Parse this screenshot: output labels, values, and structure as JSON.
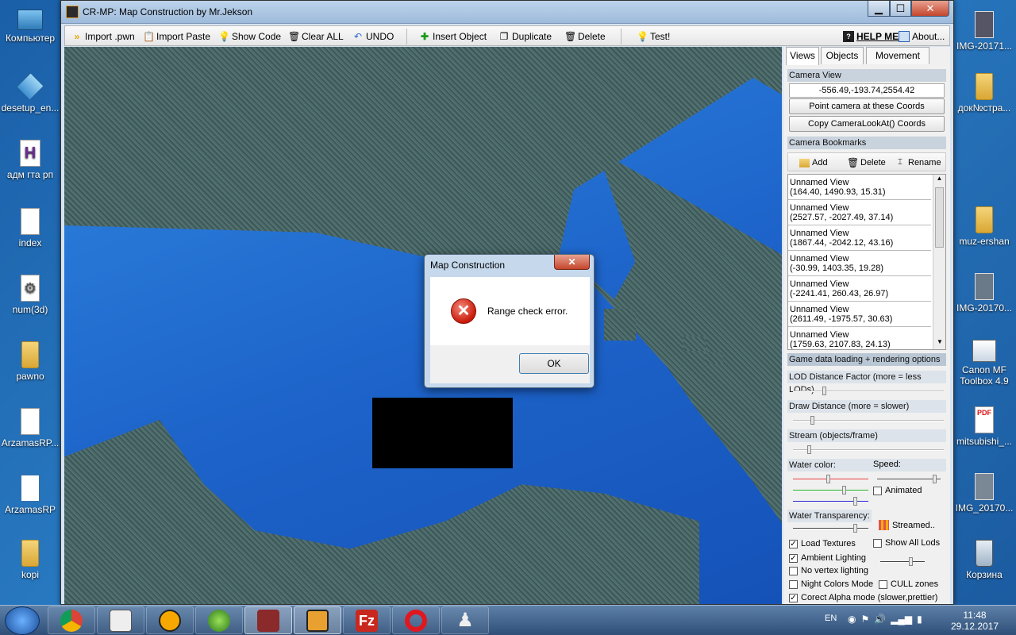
{
  "desktop": {
    "icons_left": [
      {
        "label": "Компьютер",
        "icon": "computer-icon"
      },
      {
        "label": "desetup_en...",
        "icon": "package-icon"
      },
      {
        "label": "адм гта рп",
        "icon": "h-app-icon"
      },
      {
        "label": "index",
        "icon": "text-file-icon"
      },
      {
        "label": "num(3d)",
        "icon": "settings-file-icon"
      },
      {
        "label": "pawno",
        "icon": "folder-icon"
      },
      {
        "label": "ArzamasRP...",
        "icon": "file-icon"
      },
      {
        "label": "ArzamasRP",
        "icon": "config-file-icon"
      },
      {
        "label": "kopi",
        "icon": "folder-icon"
      }
    ],
    "icons_right": [
      {
        "label": "IMG-20171...",
        "icon": "image-icon"
      },
      {
        "label": "док№стра...",
        "icon": "folder-icon"
      },
      {
        "label": "muz-ershan",
        "icon": "folder-icon"
      },
      {
        "label": "IMG-20170...",
        "icon": "image-icon"
      },
      {
        "label": "Canon MF Toolbox 4.9",
        "icon": "canon-icon"
      },
      {
        "label": "mitsubishi_...",
        "icon": "pdf-icon"
      },
      {
        "label": "IMG_20170...",
        "icon": "image-icon"
      },
      {
        "label": "Корзина",
        "icon": "recycle-bin-icon"
      }
    ]
  },
  "window": {
    "title": "CR-MP: Map Construction by Mr.Jekson",
    "controls": {
      "minimize": "▁",
      "maximize": "☐",
      "close": "✕"
    }
  },
  "toolbar": {
    "import_pwn": "Import .pwn",
    "import_paste": "Import Paste",
    "show_code": "Show Code",
    "clear_all": "Clear ALL",
    "undo": "UNDO",
    "insert_object": "Insert Object",
    "duplicate": "Duplicate",
    "delete": "Delete",
    "test": "Test!",
    "help": "HELP ME",
    "about": "About..."
  },
  "panel": {
    "tabs": [
      "Views",
      "Objects",
      "Movement"
    ],
    "camera_view_header": "Camera View",
    "camera_coords": "-556.49,-193.74,2554.42",
    "point_camera_button": "Point camera at these Coords",
    "copy_lookat_button": "Copy CameraLookAt() Coords",
    "bookmarks_header": "Camera Bookmarks",
    "bm_add": "Add",
    "bm_delete": "Delete",
    "bm_rename": "Rename",
    "bookmarks": [
      {
        "name": "Unnamed View",
        "coords": "(164.40, 1490.93, 15.31)"
      },
      {
        "name": "Unnamed View",
        "coords": "(2527.57, -2027.49, 37.14)"
      },
      {
        "name": "Unnamed View",
        "coords": "(1867.44, -2042.12, 43.16)"
      },
      {
        "name": "Unnamed View",
        "coords": "(-30.99, 1403.35, 19.28)"
      },
      {
        "name": "Unnamed View",
        "coords": "(-2241.41, 260.43, 26.97)"
      },
      {
        "name": "Unnamed View",
        "coords": "(2611.49, -1975.57, 30.63)"
      },
      {
        "name": "Unnamed View",
        "coords": "(1759.63, 2107.83, 24.13)"
      }
    ],
    "game_data_header": "Game data loading  + rendering options",
    "lod_label": "LOD Distance Factor (more = less LODs)",
    "draw_label": "Draw Distance (more = slower)",
    "stream_label": "Stream (objects/frame)",
    "water_color_label": "Water color:",
    "speed_label": "Speed:",
    "animated_label": "Animated",
    "water_transparency_label": "Water Transparency:",
    "streamed_label": "Streamed..",
    "load_textures": "Load Textures",
    "show_all_lods": "Show All Lods",
    "ambient_lighting": "Ambient Lighting",
    "no_vertex_lighting": "No vertex lighting",
    "night_colors": "Night Colors Mode",
    "cull_zones": "CULL zones",
    "correct_alpha": "Corect Alpha mode (slower,prettier)",
    "checks": {
      "load_textures": true,
      "show_all_lods": false,
      "ambient_lighting": true,
      "no_vertex_lighting": false,
      "night_colors": false,
      "cull_zones": false,
      "correct_alpha": true,
      "animated": false
    },
    "slider_levels": {
      "lod": 0.2,
      "draw": 0.12,
      "stream": 0.1,
      "red": 0.47,
      "green": 0.7,
      "blue": 0.85,
      "speed": 0.95,
      "transparency": 0.85
    }
  },
  "dialog": {
    "title": "Map Construction",
    "close": "✕",
    "message": "Range check error.",
    "ok": "OK"
  },
  "taskbar": {
    "apps": [
      "chrome-icon",
      "easy-apk-icon",
      "avast-icon",
      "dr-web-icon",
      "image-editor-icon",
      "map-construction-icon",
      "filezilla-icon",
      "opera-icon",
      "pawn-icon"
    ],
    "language": "EN",
    "time": "11:48",
    "date": "29.12.2017"
  }
}
